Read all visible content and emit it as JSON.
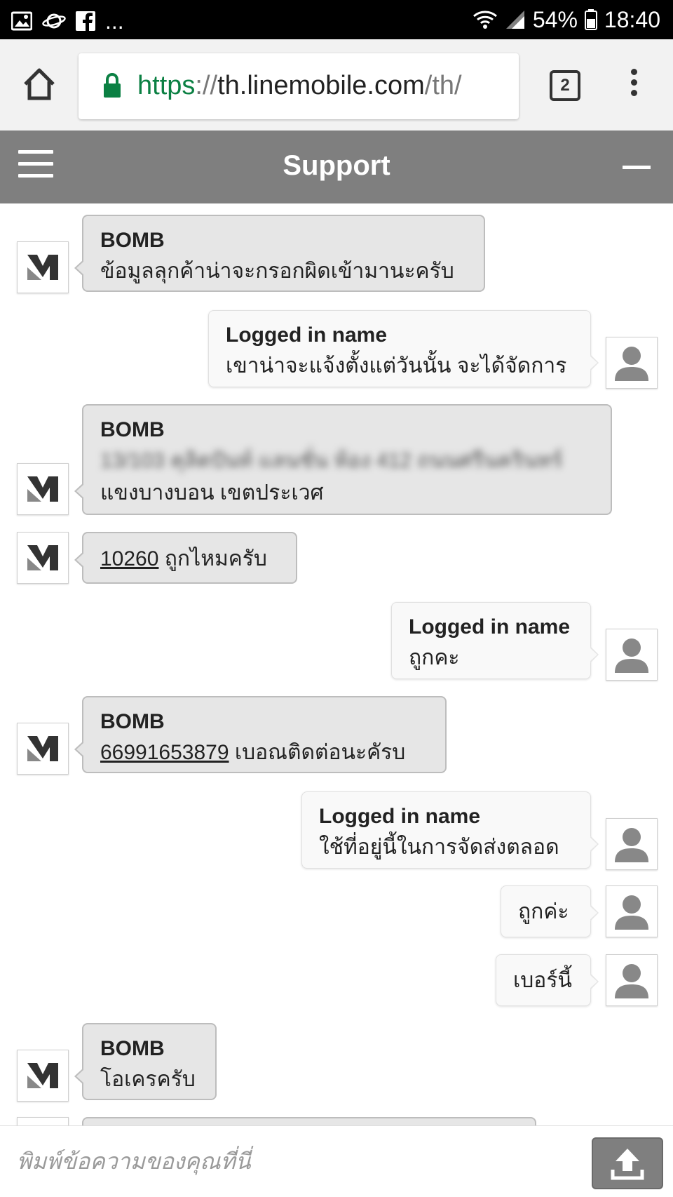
{
  "status_bar": {
    "left_icons": [
      "image-icon",
      "planet-icon",
      "facebook-icon"
    ],
    "more": "...",
    "battery": "54%",
    "time": "18:40"
  },
  "browser": {
    "url_scheme": "https",
    "url_sep": "://",
    "url_host": "th.linemobile.com",
    "url_path": "/th/",
    "tab_count": "2"
  },
  "header": {
    "title": "Support"
  },
  "messages": [
    {
      "sender": "BOMB",
      "text": "ข้อมูลลุกค้าน่าจะกรอกผิดเข้ามานะครับ"
    },
    {
      "sender": "Logged in name",
      "text": "เขาน่าจะแจ้งตั้งแต่วันนั้น จะได้จัดการ"
    },
    {
      "sender": "BOMB",
      "text_blurred": "13/103 คุลิตปันท์ แลนชั่น ห้อง 412 ถนนศรีนครินทร์",
      "text": "แขงบางบอน เขตประเวศ"
    },
    {
      "link": "10260",
      "text": " ถูกไหมครับ"
    },
    {
      "sender": "Logged in name",
      "text": "ถูกคะ"
    },
    {
      "sender": "BOMB",
      "link": "66991653879",
      "text": " เบอณติดต่อนะคัรบ"
    },
    {
      "sender": "Logged in name",
      "text": "ใช้ที่อยู่นี้ในการจัดส่งตลอด"
    },
    {
      "text": "ถูกค่ะ"
    },
    {
      "text": "เบอร์นี้"
    },
    {
      "sender": "BOMB",
      "text": "โอเครครับ"
    }
  ],
  "input": {
    "placeholder": "พิมพ์ข้อความของคุณที่นี่"
  }
}
